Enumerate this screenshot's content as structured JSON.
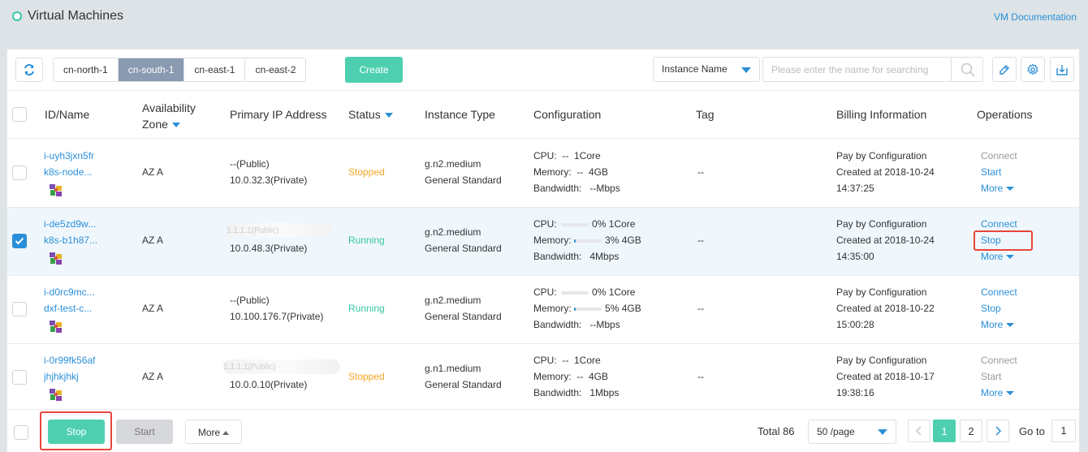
{
  "header": {
    "title": "Virtual Machines",
    "doc_link": "VM Documentation"
  },
  "toolbar": {
    "regions": [
      "cn-north-1",
      "cn-south-1",
      "cn-east-1",
      "cn-east-2"
    ],
    "active_region": "cn-south-1",
    "create_label": "Create",
    "search_field": "Instance Name",
    "search_placeholder": "Please enter the name for searching"
  },
  "table": {
    "columns": {
      "id_name": "ID/Name",
      "availability_zone": "Availability Zone",
      "primary_ip": "Primary IP Address",
      "status": "Status",
      "instance_type": "Instance Type",
      "configuration": "Configuration",
      "tag": "Tag",
      "billing": "Billing Information",
      "operations": "Operations"
    },
    "rows": [
      {
        "id": "i-uyh3jxn5fr",
        "name": "k8s-node...",
        "zone": "AZ A",
        "ip_public": "--(Public)",
        "ip_private": "10.0.32.3(Private)",
        "status": "Stopped",
        "type": "g.n2.medium",
        "type_desc": "General Standard",
        "cpu": "CPU:  --  1Core",
        "memory": "Memory:  --  4GB",
        "bandwidth": "Bandwidth:   --Mbps",
        "tag": "--",
        "billing_mode": "Pay by Configuration",
        "created": "Created at 2018-10-24",
        "created_time": "14:37:25",
        "op_connect": "Connect",
        "op_toggle": "Start",
        "op_more": "More",
        "selected": false
      },
      {
        "id": "i-de5zd9w...",
        "name": "k8s-b1h87...",
        "zone": "AZ A",
        "ip_public": "1.1.1.1(Public)",
        "ip_private": "10.0.48.3(Private)",
        "status": "Running",
        "type": "g.n2.medium",
        "type_desc": "General Standard",
        "cpu_label": "CPU:",
        "cpu_pct": "0%",
        "cpu_val": "1Core",
        "cpu_frac": 0.0,
        "mem_label": "Memory:",
        "mem_pct": "3%",
        "mem_val": "4GB",
        "mem_frac": 0.03,
        "bandwidth": "Bandwidth:   4Mbps",
        "tag": "--",
        "billing_mode": "Pay by Configuration",
        "created": "Created at 2018-10-24",
        "created_time": "14:35:00",
        "op_connect": "Connect",
        "op_toggle": "Stop",
        "op_more": "More",
        "selected": true
      },
      {
        "id": "i-d0rc9mc...",
        "name": "dxf-test-c...",
        "zone": "AZ A",
        "ip_public": "--(Public)",
        "ip_private": "10.100.176.7(Private)",
        "status": "Running",
        "type": "g.n2.medium",
        "type_desc": "General Standard",
        "cpu_label": "CPU:",
        "cpu_pct": "0%",
        "cpu_val": "1Core",
        "cpu_frac": 0.0,
        "mem_label": "Memory:",
        "mem_pct": "5%",
        "mem_val": "4GB",
        "mem_frac": 0.05,
        "bandwidth": "Bandwidth:   --Mbps",
        "tag": "--",
        "billing_mode": "Pay by Configuration",
        "created": "Created at 2018-10-22",
        "created_time": "15:00:28",
        "op_connect": "Connect",
        "op_toggle": "Stop",
        "op_more": "More",
        "selected": false
      },
      {
        "id": "i-0r99fk56af",
        "name": "jhjhkjhkj",
        "zone": "AZ A",
        "ip_public": "1.1.1.1(Public)",
        "ip_private": "10.0.0.10(Private)",
        "status": "Stopped",
        "type": "g.n1.medium",
        "type_desc": "General Standard",
        "cpu": "CPU:  --  1Core",
        "memory": "Memory:  --  4GB",
        "bandwidth": "Bandwidth:   1Mbps",
        "tag": "--",
        "billing_mode": "Pay by Configuration",
        "created": "Created at 2018-10-17",
        "created_time": "19:38:16",
        "op_connect": "Connect",
        "op_toggle": "Start",
        "op_more": "More",
        "selected": false
      }
    ]
  },
  "footer": {
    "stop_label": "Stop",
    "start_label": "Start",
    "more_label": "More",
    "total": "Total 86",
    "page_size": "50 /page",
    "pages": [
      "1",
      "2"
    ],
    "current_page": "1",
    "goto_label": "Go to",
    "goto_value": "1"
  },
  "colors": {
    "accent": "#4ed0b0",
    "link": "#2a8fd8",
    "stopped": "#f5a623",
    "running": "#35c6a6",
    "highlight": "#e8443a"
  }
}
